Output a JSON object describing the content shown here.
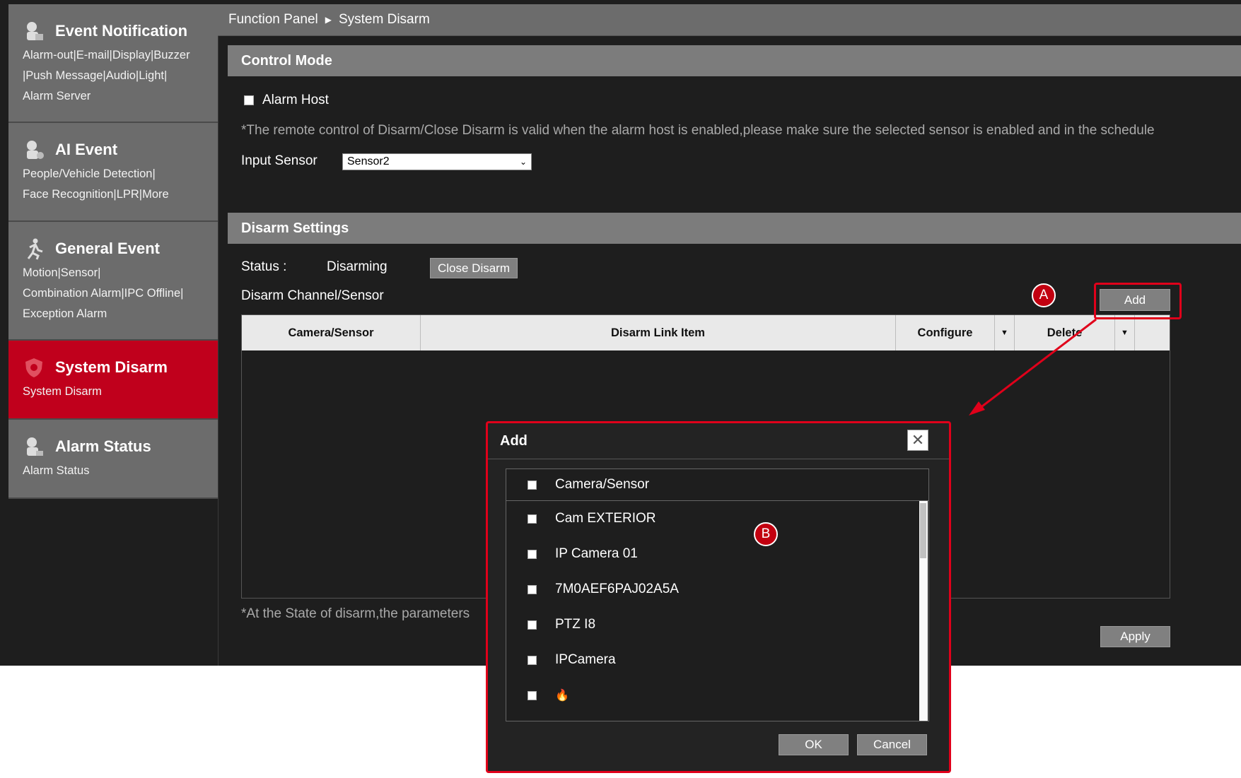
{
  "sidebar": {
    "items": [
      {
        "title": "Event Notification",
        "sub": "Alarm-out|E-mail|Display|Buzzer\n|Push Message|Audio|Light|\nAlarm Server",
        "icon": "bell-person-icon"
      },
      {
        "title": "AI Event",
        "sub": "People/Vehicle Detection|\nFace Recognition|LPR|More",
        "icon": "ai-person-icon"
      },
      {
        "title": "General Event",
        "sub": "Motion|Sensor|\nCombination Alarm|IPC Offline|\nException Alarm",
        "icon": "running-figure-icon"
      },
      {
        "title": "System Disarm",
        "sub": "System Disarm",
        "icon": "shield-icon",
        "active": true
      },
      {
        "title": "Alarm Status",
        "sub": "Alarm Status",
        "icon": "alarm-person-icon"
      }
    ]
  },
  "breadcrumb": {
    "root": "Function Panel",
    "current": "System Disarm"
  },
  "control_mode": {
    "heading": "Control Mode",
    "alarm_host_label": "Alarm Host",
    "note": "*The remote control of Disarm/Close Disarm is valid when the alarm host is enabled,please make sure the selected sensor is enabled and in the schedule",
    "input_sensor_label": "Input Sensor",
    "input_sensor_value": "Sensor2"
  },
  "disarm_settings": {
    "heading": "Disarm Settings",
    "status_label": "Status :",
    "status_value": "Disarming",
    "close_disarm_button": "Close Disarm",
    "channel_label": "Disarm Channel/Sensor",
    "add_button": "Add",
    "columns": [
      "Camera/Sensor",
      "Disarm Link Item",
      "Configure",
      "Delete"
    ],
    "footer_note": "*At the State of disarm,the parameters",
    "apply_button": "Apply"
  },
  "annotations": {
    "a": "A",
    "b": "B",
    "accent_color": "#e0001a"
  },
  "dialog": {
    "title": "Add",
    "header_label": "Camera/Sensor",
    "rows": [
      "Cam EXTERIOR",
      "IP Camera 01",
      "7M0AEF6PAJ02A5A",
      "PTZ I8",
      "IPCamera",
      "🔥"
    ],
    "ok_button": "OK",
    "cancel_button": "Cancel"
  }
}
